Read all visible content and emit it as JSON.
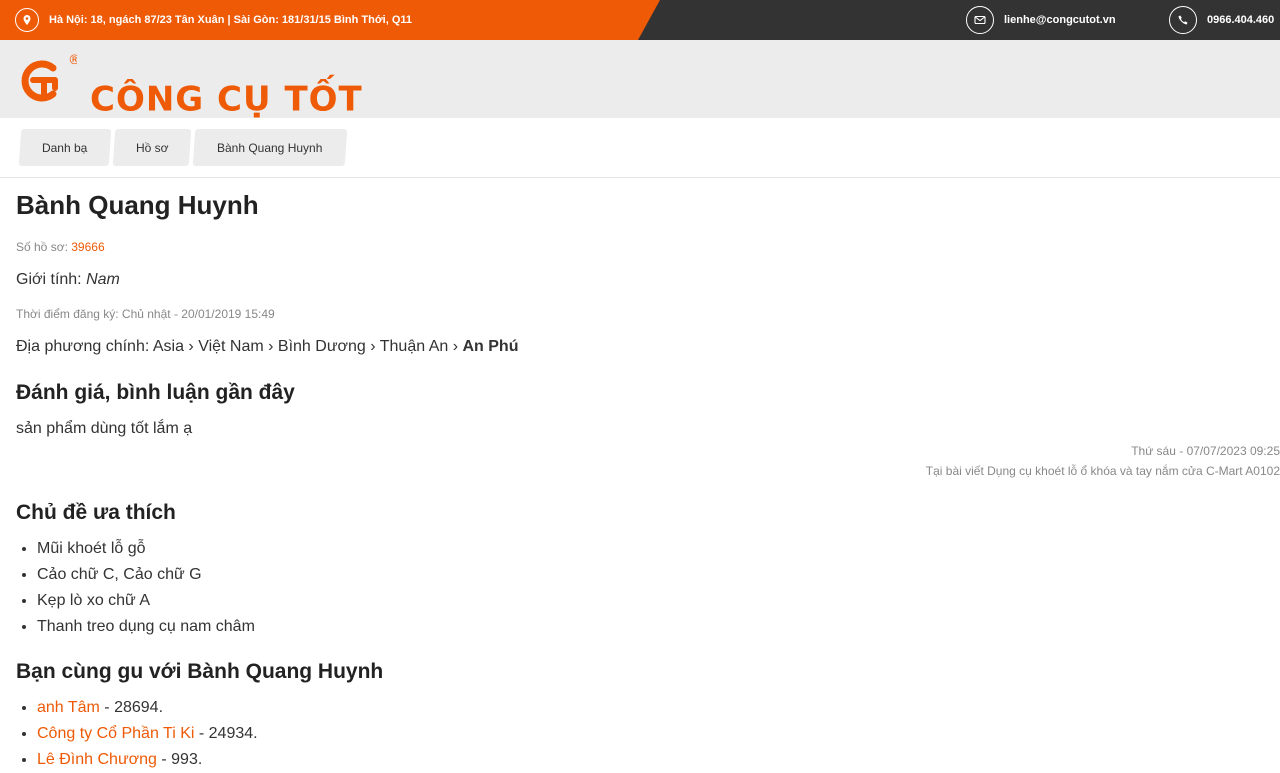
{
  "topbar": {
    "address": "Hà Nội: 18, ngách 87/23 Tân Xuân | Sài Gòn: 181/31/15 Bình Thới, Q11",
    "email": "lienhe@congcutot.vn",
    "phone": "0966.404.460"
  },
  "logo": {
    "text": "CÔNG CỤ TỐT",
    "registered_mark": "®"
  },
  "breadcrumb": [
    "Danh bạ",
    "Hồ sơ",
    "Bành Quang Huynh"
  ],
  "profile": {
    "name": "Bành Quang Huynh",
    "file_label": "Số hồ sơ:",
    "file_number": "39666",
    "gender_label": "Giới tính:",
    "gender": "Nam",
    "registered": "Thời điểm đăng ký: Chủ nhật - 20/01/2019 15:49",
    "location_label": "Địa phương chính:",
    "location_path": "Asia › Việt Nam › Bình Dương › Thuận An ›",
    "location_last": "An Phú"
  },
  "reviews": {
    "heading": "Đánh giá, bình luận gần đây",
    "items": [
      {
        "text": "sản phẩm dùng tốt lắm ạ",
        "date": "Thứ sáu - 07/07/2023 09:25",
        "source": "Tại bài viết Dụng cụ khoét lỗ ổ khóa và tay nắm cửa C-Mart A0102"
      }
    ]
  },
  "favorites": {
    "heading": "Chủ đề ưa thích",
    "items": [
      "Mũi khoét lỗ gỗ",
      "Cảo chữ C, Cảo chữ G",
      "Kẹp lò xo chữ A",
      "Thanh treo dụng cụ nam châm"
    ]
  },
  "friends": {
    "heading": "Bạn cùng gu với Bành Quang Huynh",
    "items": [
      {
        "name": "anh Tâm",
        "suffix": " - 28694."
      },
      {
        "name": "Công ty Cổ Phần Ti Ki",
        "suffix": " - 24934."
      },
      {
        "name": "Lê Đình Chương",
        "suffix": " - 993."
      }
    ]
  },
  "colors": {
    "brand": "#ee5a06",
    "topbar_dark": "#333333",
    "band": "#ececec"
  }
}
